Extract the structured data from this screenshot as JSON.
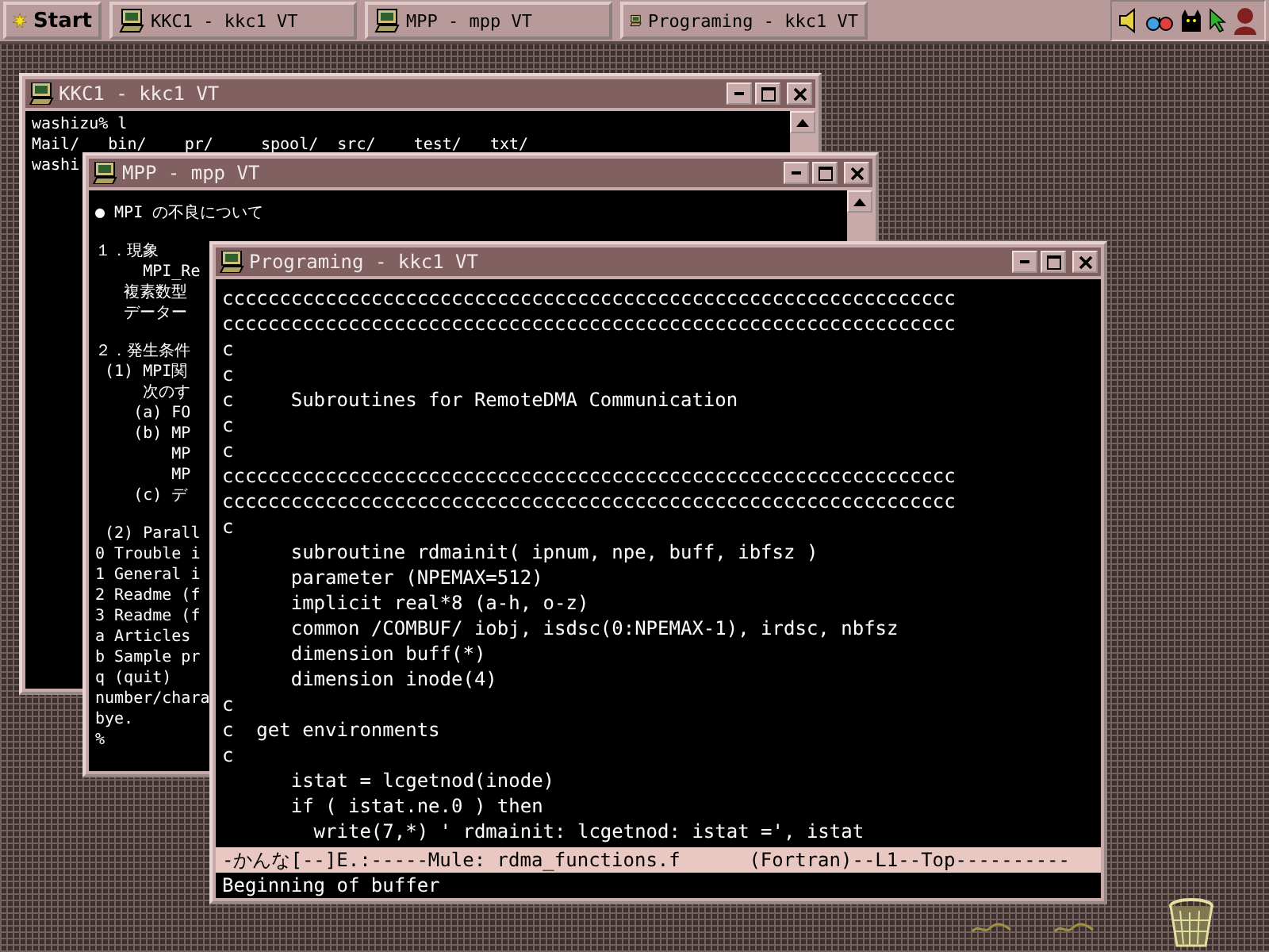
{
  "taskbar": {
    "start_label": "Start",
    "tasks": [
      {
        "label": "KKC1 - kkc1 VT"
      },
      {
        "label": "MPP - mpp VT"
      },
      {
        "label": "Programing - kkc1 VT"
      }
    ]
  },
  "kkc1_window": {
    "title": "KKC1 - kkc1 VT",
    "lines": [
      "washizu% l",
      "Mail/   bin/    pr/     spool/  src/    test/   txt/",
      "washi"
    ]
  },
  "mpp_window": {
    "title": "MPP - mpp VT",
    "paragraphs": [
      [
        "● MPI の不良について"
      ],
      [
        "１．現象",
        "     MPI_Re",
        "   複素数型",
        "   データー"
      ],
      [
        "２．発生条件",
        " (1) MPI関",
        "     次のす",
        "    (a) FO",
        "    (b) MP",
        "        MP",
        "        MP",
        "    (c) デ"
      ],
      [
        " (2) Parall",
        "0 Trouble i",
        "1 General i",
        "2 Readme (f",
        "3 Readme (f",
        "a Articles",
        "b Sample pr",
        "q (quit)",
        "number/chara",
        "bye.",
        "%"
      ]
    ]
  },
  "programing_window": {
    "title": "Programing - kkc1 VT",
    "lines": [
      "cccccccccccccccccccccccccccccccccccccccccccccccccccccccccccccccc",
      "cccccccccccccccccccccccccccccccccccccccccccccccccccccccccccccccc",
      "c",
      "c",
      "c     Subroutines for RemoteDMA Communication",
      "c",
      "c",
      "cccccccccccccccccccccccccccccccccccccccccccccccccccccccccccccccc",
      "cccccccccccccccccccccccccccccccccccccccccccccccccccccccccccccccc",
      "c",
      "      subroutine rdmainit( ipnum, npe, buff, ibfsz )",
      "      parameter (NPEMAX=512)",
      "      implicit real*8 (a-h, o-z)",
      "      common /COMBUF/ iobj, isdsc(0:NPEMAX-1), irdsc, nbfsz",
      "      dimension buff(*)",
      "      dimension inode(4)",
      "c",
      "c  get environments",
      "c",
      "      istat = lcgetnod(inode)",
      "      if ( istat.ne.0 ) then",
      "        write(7,*) ' rdmainit: lcgetnod: istat =', istat"
    ],
    "mode_line": "-かんな[--]E.:-----Mule: rdma_functions.f      (Fortran)--L1--Top----------",
    "minibuffer": "Beginning of buffer"
  }
}
